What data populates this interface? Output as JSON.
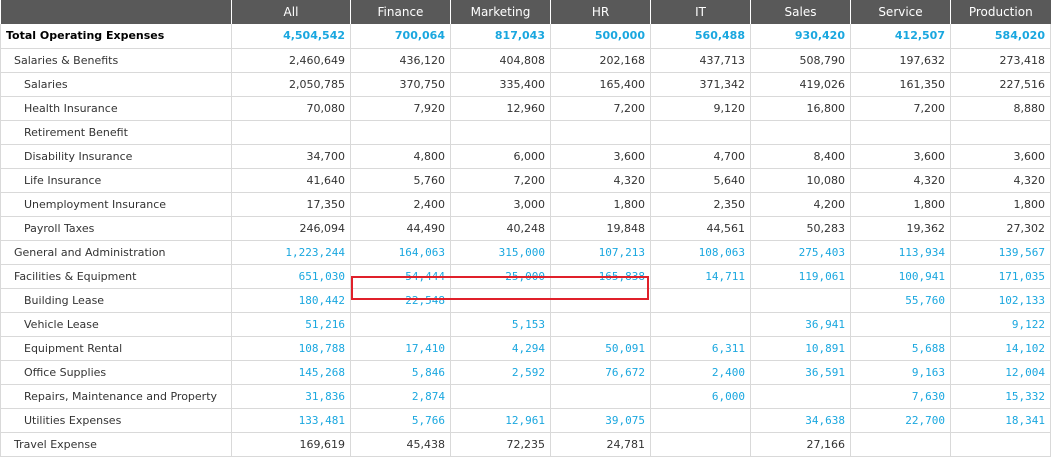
{
  "columns": [
    "All",
    "Finance",
    "Marketing",
    "HR",
    "IT",
    "Sales",
    "Service",
    "Production"
  ],
  "rows": [
    {
      "level": 0,
      "style": "total",
      "label": "Total Operating Expenses",
      "values": [
        "4,504,542",
        "700,064",
        "817,043",
        "500,000",
        "560,488",
        "930,420",
        "412,507",
        "584,020"
      ]
    },
    {
      "level": 1,
      "style": "normal",
      "label": "Salaries & Benefits",
      "values": [
        "2,460,649",
        "436,120",
        "404,808",
        "202,168",
        "437,713",
        "508,790",
        "197,632",
        "273,418"
      ]
    },
    {
      "level": 2,
      "style": "normal",
      "label": "Salaries",
      "values": [
        "2,050,785",
        "370,750",
        "335,400",
        "165,400",
        "371,342",
        "419,026",
        "161,350",
        "227,516"
      ]
    },
    {
      "level": 2,
      "style": "normal",
      "label": "Health Insurance",
      "values": [
        "70,080",
        "7,920",
        "12,960",
        "7,200",
        "9,120",
        "16,800",
        "7,200",
        "8,880"
      ]
    },
    {
      "level": 2,
      "style": "normal",
      "label": "Retirement Benefit",
      "values": [
        "",
        "",
        "",
        "",
        "",
        "",
        "",
        ""
      ]
    },
    {
      "level": 2,
      "style": "normal",
      "label": "Disability  Insurance",
      "values": [
        "34,700",
        "4,800",
        "6,000",
        "3,600",
        "4,700",
        "8,400",
        "3,600",
        "3,600"
      ]
    },
    {
      "level": 2,
      "style": "normal",
      "label": "Life Insurance",
      "values": [
        "41,640",
        "5,760",
        "7,200",
        "4,320",
        "5,640",
        "10,080",
        "4,320",
        "4,320"
      ]
    },
    {
      "level": 2,
      "style": "normal",
      "label": "Unemployment Insurance",
      "values": [
        "17,350",
        "2,400",
        "3,000",
        "1,800",
        "2,350",
        "4,200",
        "1,800",
        "1,800"
      ]
    },
    {
      "level": 2,
      "style": "normal",
      "label": "Payroll Taxes",
      "values": [
        "246,094",
        "44,490",
        "40,248",
        "19,848",
        "44,561",
        "50,283",
        "19,362",
        "27,302"
      ]
    },
    {
      "level": 1,
      "style": "blue",
      "label": "General and Administration",
      "values": [
        "1,223,244",
        "164,063",
        "315,000",
        "107,213",
        "108,063",
        "275,403",
        "113,934",
        "139,567"
      ]
    },
    {
      "level": 1,
      "style": "blue",
      "label": "Facilities & Equipment",
      "values": [
        "651,030",
        "54,444",
        "25,000",
        "165,838",
        "14,711",
        "119,061",
        "100,941",
        "171,035"
      ]
    },
    {
      "level": 2,
      "style": "blue",
      "label": "Building Lease",
      "values": [
        "180,442",
        "22,548",
        "",
        "",
        "",
        "",
        "55,760",
        "102,133"
      ]
    },
    {
      "level": 2,
      "style": "blue",
      "label": "Vehicle Lease",
      "values": [
        "51,216",
        "",
        "5,153",
        "",
        "",
        "36,941",
        "",
        "9,122"
      ]
    },
    {
      "level": 2,
      "style": "blue",
      "label": "Equipment Rental",
      "values": [
        "108,788",
        "17,410",
        "4,294",
        "50,091",
        "6,311",
        "10,891",
        "5,688",
        "14,102"
      ]
    },
    {
      "level": 2,
      "style": "blue",
      "label": "Office Supplies",
      "values": [
        "145,268",
        "5,846",
        "2,592",
        "76,672",
        "2,400",
        "36,591",
        "9,163",
        "12,004"
      ]
    },
    {
      "level": 2,
      "style": "blue",
      "label": "Repairs, Maintenance and Property",
      "values": [
        "31,836",
        "2,874",
        "",
        "",
        "6,000",
        "",
        "7,630",
        "15,332"
      ]
    },
    {
      "level": 2,
      "style": "blue",
      "label": "Utilities Expenses",
      "values": [
        "133,481",
        "5,766",
        "12,961",
        "39,075",
        "",
        "34,638",
        "22,700",
        "18,341"
      ]
    },
    {
      "level": 1,
      "style": "normal",
      "label": "Travel Expense",
      "values": [
        "169,619",
        "45,438",
        "72,235",
        "24,781",
        "",
        "27,166",
        "",
        ""
      ]
    }
  ],
  "selection": {
    "row_label": "Facilities & Equipment",
    "columns": [
      "Finance",
      "Marketing",
      "HR"
    ],
    "border_color": "#e0202a"
  },
  "colors": {
    "header_bg": "#595959",
    "header_text": "#ffffff",
    "link_value": "#1aa7df",
    "grid_line": "#d9d9d9"
  }
}
